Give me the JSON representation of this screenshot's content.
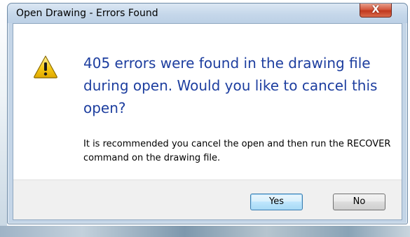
{
  "window": {
    "title": "Open Drawing - Errors Found",
    "close_symbol": "X"
  },
  "message": {
    "icon": "warning-icon",
    "main_instruction": "405 errors were found in the drawing file during open. Would you like to cancel this open?",
    "detail": "It is recommended you cancel the open and then run the RECOVER command on the drawing file."
  },
  "buttons": {
    "yes_label": "Yes",
    "no_label": "No",
    "default": "yes"
  },
  "colors": {
    "instruction_text": "#1d3e9f",
    "close_button": "#c1381e",
    "titlebar": "#c5d7ea",
    "footer": "#f0f0f0",
    "warning_fill": "#f6c915"
  }
}
